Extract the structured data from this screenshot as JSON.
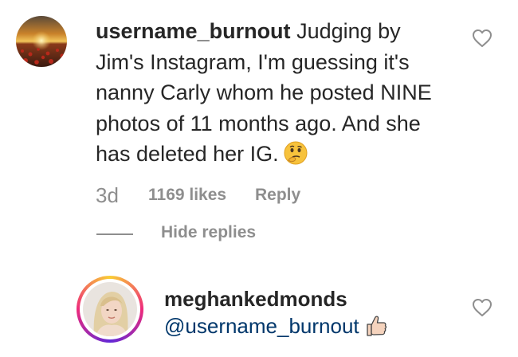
{
  "comment": {
    "username": "username_burnout",
    "text": "Judging by Jim's Instagram, I'm guessing it's nanny Carly whom he posted NINE photos of 11 months ago. And she has deleted her IG.",
    "emoji": "thinking-face-emoji",
    "time": "3d",
    "likes": "1169 likes",
    "reply_label": "Reply",
    "hide_replies_label": "Hide replies"
  },
  "reply": {
    "username": "meghankedmonds",
    "text": "@username_burnout",
    "emoji": "thumbs-up-emoji"
  },
  "icons": {
    "like": "heart-outline-icon"
  },
  "colors": {
    "text": "#262626",
    "muted": "#8e8e8e",
    "mention": "#00376b"
  }
}
